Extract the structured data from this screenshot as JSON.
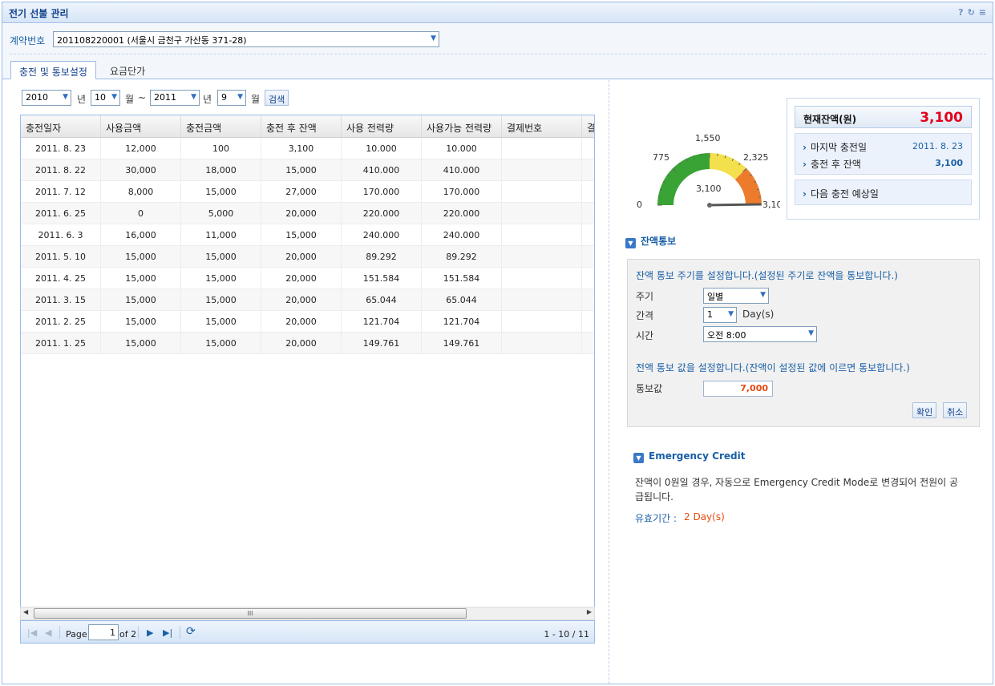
{
  "header": {
    "title": "전기 선불 관리",
    "tools": [
      "?",
      "↻",
      "≡"
    ]
  },
  "contract": {
    "label": "계약번호",
    "selected": "201108220001 (서울시 금천구 가산동 371-28)"
  },
  "tabs": [
    {
      "label": "충전 및 통보설정",
      "active": true
    },
    {
      "label": "요금단가",
      "active": false
    }
  ],
  "filter": {
    "start_year": "2010",
    "year_suffix": "년",
    "start_month": "10",
    "month_suffix": "월",
    "tilde": "~",
    "end_year": "2011",
    "end_month": "9",
    "search_label": "검색"
  },
  "grid": {
    "columns": [
      "충전일자",
      "사용금액",
      "충전금액",
      "충전 후 잔액",
      "사용 전력량",
      "사용가능 전력량",
      "결제번호",
      "결"
    ],
    "rows": [
      [
        "2011. 8. 23",
        "12,000",
        "100",
        "3,100",
        "10.000",
        "10.000",
        ""
      ],
      [
        "2011. 8. 22",
        "30,000",
        "18,000",
        "15,000",
        "410.000",
        "410.000",
        ""
      ],
      [
        "2011. 7. 12",
        "8,000",
        "15,000",
        "27,000",
        "170.000",
        "170.000",
        ""
      ],
      [
        "2011. 6. 25",
        "0",
        "5,000",
        "20,000",
        "220.000",
        "220.000",
        ""
      ],
      [
        "2011. 6. 3",
        "16,000",
        "11,000",
        "15,000",
        "240.000",
        "240.000",
        ""
      ],
      [
        "2011. 5. 10",
        "15,000",
        "15,000",
        "20,000",
        "89.292",
        "89.292",
        ""
      ],
      [
        "2011. 4. 25",
        "15,000",
        "15,000",
        "20,000",
        "151.584",
        "151.584",
        ""
      ],
      [
        "2011. 3. 15",
        "15,000",
        "15,000",
        "20,000",
        "65.044",
        "65.044",
        ""
      ],
      [
        "2011. 2. 25",
        "15,000",
        "15,000",
        "20,000",
        "121.704",
        "121.704",
        ""
      ],
      [
        "2011. 1. 25",
        "15,000",
        "15,000",
        "20,000",
        "149.761",
        "149.761",
        ""
      ]
    ],
    "scroll_grip": "III"
  },
  "pager": {
    "page_label": "Page",
    "page_value": "1",
    "of_label": "of 2",
    "display_info": "1 - 10 / 11"
  },
  "gauge": {
    "value": 3100,
    "max": 3100,
    "labels": {
      "min": "0",
      "q1": "775",
      "mid": "1,550",
      "q3": "2,325",
      "max": "3,10",
      "value": "3,100"
    },
    "colors": {
      "green": "#3aa335",
      "yellow": "#f3e04c",
      "orange": "#ec7c2c"
    }
  },
  "balance": {
    "label": "현재잔액(원)",
    "value": "3,100",
    "last_charge_label": "마지막 충전일",
    "last_charge_value": "2011. 8. 23",
    "after_balance_label": "충전 후 잔액",
    "after_balance_value": "3,100",
    "next_charge_label": "다음 충전 예상일"
  },
  "notify": {
    "title": "잔액통보",
    "period_desc": "잔액 통보 주기를 설정합니다.(설정된 주기로 잔액을 통보합니다.)",
    "cycle_label": "주기",
    "cycle_value": "일별",
    "interval_label": "간격",
    "interval_value": "1",
    "interval_unit": "Day(s)",
    "time_label": "시간",
    "time_value": "오전 8:00",
    "value_desc": "전액 통보 값을 설정합니다.(잔액이 설정된 값에 이르면 통보합니다.)",
    "value_label": "통보값",
    "value_value": "7,000",
    "confirm_label": "확인",
    "cancel_label": "취소"
  },
  "emergency": {
    "title": "Emergency Credit",
    "desc_line1": "잔액이 0원일 경우, 자동으로 Emergency Credit Mode로 변경되어 전원이 공",
    "desc_line2": "급됩니다.",
    "validity_label": "유효기간 :",
    "validity_value": "2 Day(s)"
  }
}
